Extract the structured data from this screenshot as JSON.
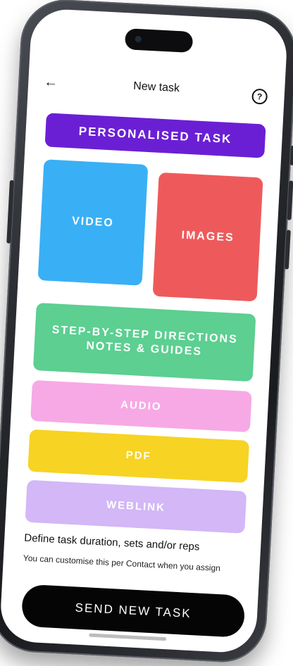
{
  "header": {
    "back_icon": "←",
    "title": "New task",
    "help_icon": "?"
  },
  "tiles": {
    "personalised": "PERSONALISED TASK",
    "video": "VIDEO",
    "images": "IMAGES",
    "steps_line1": "STEP-BY-STEP DIRECTIONS",
    "steps_line2": "NOTES & GUIDES",
    "audio": "AUDIO",
    "pdf": "PDF",
    "weblink": "WEBLINK"
  },
  "footer": {
    "define_text": "Define task duration, sets and/or reps",
    "customise_text": "You can customise this per Contact when you assign",
    "send_label": "SEND NEW TASK"
  },
  "colors": {
    "personalised": "#6b1fd4",
    "video": "#39b0f5",
    "images": "#ee5a5b",
    "steps": "#5ccf91",
    "audio": "#f7a9e6",
    "pdf": "#f7d323",
    "weblink": "#d3b7f7",
    "send_button": "#050505"
  }
}
